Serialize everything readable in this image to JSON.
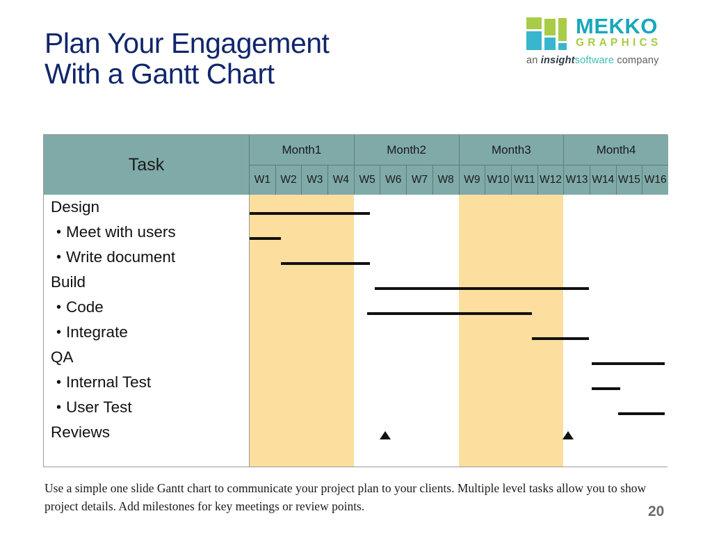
{
  "title": {
    "line1": "Plan Your Engagement",
    "line2": "With a Gantt Chart",
    "color": "#11266b"
  },
  "logo": {
    "brand": "MEKKO",
    "sub": "GRAPHICS",
    "tagline_pre": "an ",
    "tagline_insight": "insight",
    "tagline_software": "software",
    "tagline_post": " company",
    "brand_color": "#17a8bd",
    "sub_color": "#a8cc46",
    "mark_green": "#a8cc46",
    "mark_cyan": "#38b6cd"
  },
  "table": {
    "task_header": "Task",
    "header_bg": "#7faaa8",
    "highlight_color": "#fcdf9e",
    "bar_color": "#111111",
    "months": [
      "Month1",
      "Month2",
      "Month3",
      "Month4"
    ],
    "weeks": [
      "W1",
      "W2",
      "W3",
      "W4",
      "W5",
      "W6",
      "W7",
      "W8",
      "W9",
      "W10",
      "W11",
      "W12",
      "W13",
      "W14",
      "W15",
      "W16"
    ],
    "rows": [
      {
        "label": "Design",
        "level": 0
      },
      {
        "label": "Meet with users",
        "level": 1
      },
      {
        "label": "Write document",
        "level": 1
      },
      {
        "label": "Build",
        "level": 0
      },
      {
        "label": "Code",
        "level": 1
      },
      {
        "label": "Integrate",
        "level": 1
      },
      {
        "label": "QA",
        "level": 0
      },
      {
        "label": "Internal Test",
        "level": 1
      },
      {
        "label": "User Test",
        "level": 1
      },
      {
        "label": "Reviews",
        "level": 0
      }
    ]
  },
  "footer": {
    "text": "Use a simple one slide Gantt chart to communicate your project plan to your clients.  Multiple level tasks allow you to show project details.  Add milestones for key meetings or review points.",
    "page_number": "20"
  },
  "chart_data": {
    "type": "gantt",
    "title": "Plan Your Engagement With a Gantt Chart",
    "x_unit": "week",
    "x_range": [
      1,
      17
    ],
    "categories": [
      "Month1",
      "Month2",
      "Month3",
      "Month4"
    ],
    "tick_labels": [
      "W1",
      "W2",
      "W3",
      "W4",
      "W5",
      "W6",
      "W7",
      "W8",
      "W9",
      "W10",
      "W11",
      "W12",
      "W13",
      "W14",
      "W15",
      "W16"
    ],
    "highlight_bands": [
      {
        "label": "Month1",
        "start_week": 1,
        "end_week": 5
      },
      {
        "label": "Month3",
        "start_week": 9,
        "end_week": 13
      }
    ],
    "tasks": [
      {
        "name": "Design",
        "level": 0,
        "start_week": 1.0,
        "end_week": 5.6,
        "type": "bar"
      },
      {
        "name": "Meet with users",
        "level": 1,
        "start_week": 1.0,
        "end_week": 2.2,
        "type": "bar"
      },
      {
        "name": "Write document",
        "level": 1,
        "start_week": 2.2,
        "end_week": 5.6,
        "type": "bar"
      },
      {
        "name": "Build",
        "level": 0,
        "start_week": 5.8,
        "end_week": 14.0,
        "type": "bar"
      },
      {
        "name": "Code",
        "level": 1,
        "start_week": 5.5,
        "end_week": 11.8,
        "type": "bar"
      },
      {
        "name": "Integrate",
        "level": 1,
        "start_week": 11.8,
        "end_week": 14.0,
        "type": "bar"
      },
      {
        "name": "QA",
        "level": 0,
        "start_week": 14.1,
        "end_week": 16.9,
        "type": "bar"
      },
      {
        "name": "Internal Test",
        "level": 1,
        "start_week": 14.1,
        "end_week": 15.2,
        "type": "bar"
      },
      {
        "name": "User Test",
        "level": 1,
        "start_week": 15.1,
        "end_week": 16.9,
        "type": "bar"
      },
      {
        "name": "Reviews",
        "level": 0,
        "milestones": [
          6.2,
          13.2
        ],
        "type": "milestone"
      }
    ]
  }
}
